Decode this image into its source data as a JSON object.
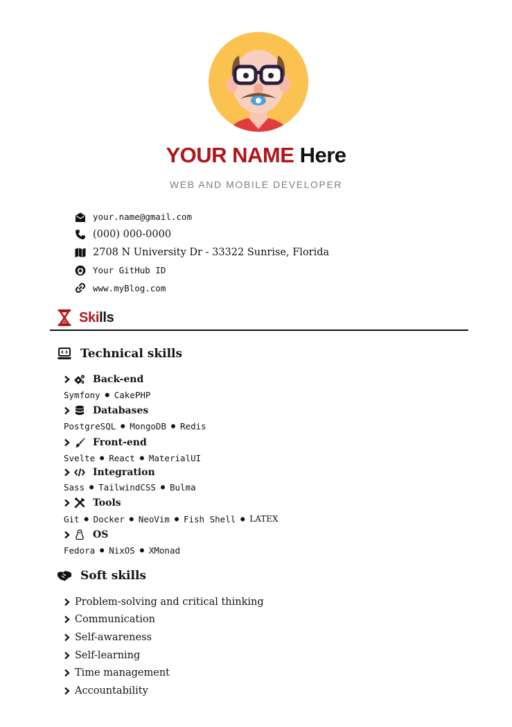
{
  "header": {
    "first_name": "YOUR NAME",
    "last_name": "Here",
    "role": "WEB AND MOBILE DEVELOPER"
  },
  "contacts": [
    {
      "icon": "envelope-icon",
      "text": "your.name@gmail.com",
      "font": "mono"
    },
    {
      "icon": "phone-icon",
      "text": "(000) 000-0000",
      "font": "serif"
    },
    {
      "icon": "map-icon",
      "text": "2708 N University Dr - 33322 Sunrise, Florida",
      "font": "serif"
    },
    {
      "icon": "github-icon",
      "text": "Your GitHub ID",
      "font": "mono"
    },
    {
      "icon": "link-icon",
      "text": "www.myBlog.com",
      "font": "mono"
    }
  ],
  "section": {
    "title_accent": "Ski",
    "title_rest": "lls",
    "icon": "hourglass-icon"
  },
  "technical": {
    "title": "Technical skills",
    "icon": "laptop-code-icon",
    "categories": [
      {
        "label": "Back-end",
        "icon": "cogs-icon",
        "items": [
          "Symfony",
          "CakePHP"
        ]
      },
      {
        "label": "Databases",
        "icon": "database-icon",
        "items": [
          "PostgreSQL",
          "MongoDB",
          "Redis"
        ]
      },
      {
        "label": "Front-end",
        "icon": "paint-brush-icon",
        "items": [
          "Svelte",
          "React",
          "MaterialUI"
        ]
      },
      {
        "label": "Integration",
        "icon": "code-icon",
        "items": [
          "Sass",
          "TailwindCSS",
          "Bulma"
        ]
      },
      {
        "label": "Tools",
        "icon": "tools-icon",
        "items": [
          "Git",
          "Docker",
          "NeoVim",
          "Fish Shell",
          "LATEX"
        ]
      },
      {
        "label": "OS",
        "icon": "linux-icon",
        "items": [
          "Fedora",
          "NixOS",
          "XMonad"
        ]
      }
    ]
  },
  "soft": {
    "title": "Soft skills",
    "icon": "handshake-icon",
    "items": [
      "Problem-solving and critical thinking",
      "Communication",
      "Self-awareness",
      "Self-learning",
      "Time management",
      "Accountability"
    ]
  },
  "colors": {
    "accent": "#b0151a",
    "avatar_bg": "#fbc251",
    "muted": "#7d7d7d"
  }
}
